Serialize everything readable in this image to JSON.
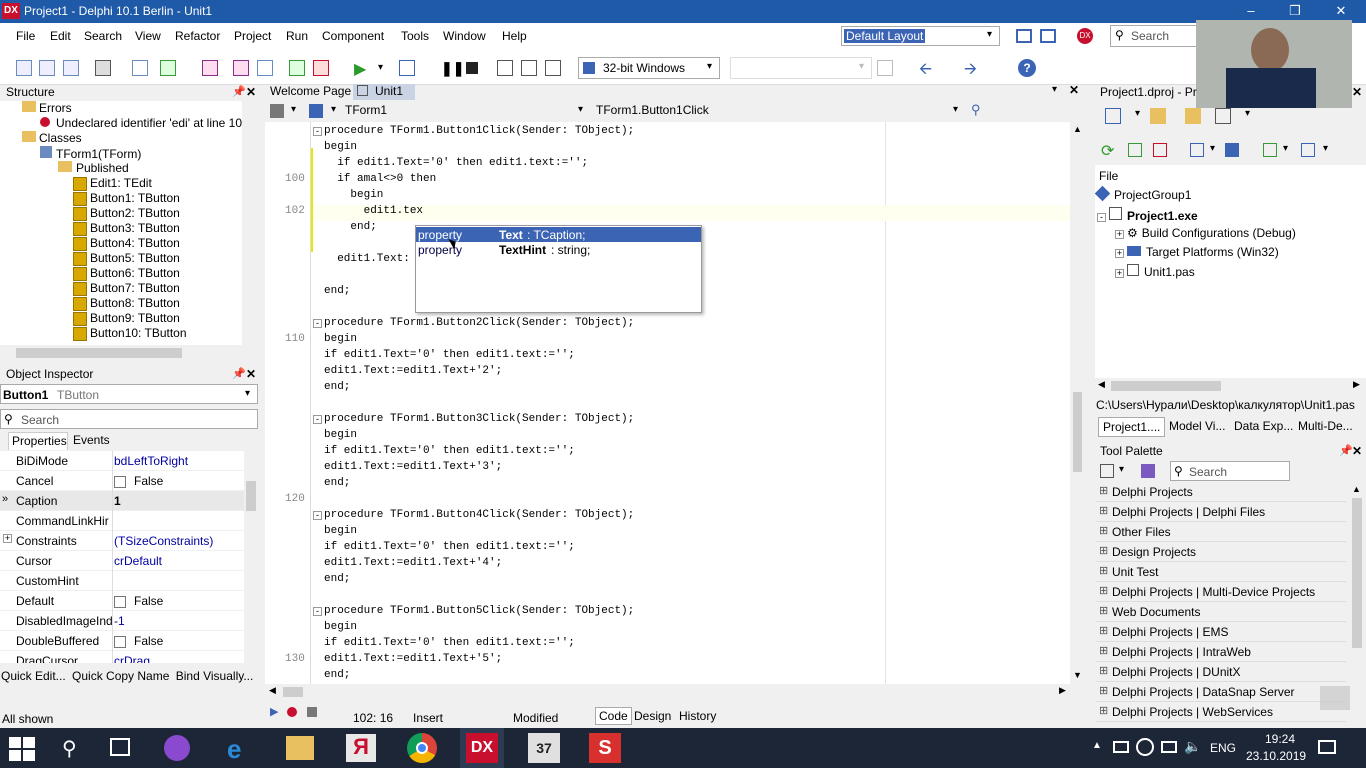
{
  "window": {
    "title": "Project1 - Delphi 10.1 Berlin - Unit1",
    "logo": "DX"
  },
  "menu": [
    "File",
    "Edit",
    "Search",
    "View",
    "Refactor",
    "Project",
    "Run",
    "Component",
    "Tools",
    "Window",
    "Help"
  ],
  "layout_select": "Default Layout",
  "top_search_placeholder": "Search",
  "platform_select": "32-bit Windows",
  "structure": {
    "title": "Structure",
    "errors_label": "Errors",
    "error_text": "Undeclared identifier 'edi' at line 10",
    "classes_label": "Classes",
    "form_label": "TForm1(TForm)",
    "published_label": "Published",
    "items": [
      "Edit1: TEdit",
      "Button1: TButton",
      "Button2: TButton",
      "Button3: TButton",
      "Button4: TButton",
      "Button5: TButton",
      "Button6: TButton",
      "Button7: TButton",
      "Button8: TButton",
      "Button9: TButton",
      "Button10: TButton"
    ]
  },
  "object_inspector": {
    "title": "Object Inspector",
    "selected_name": "Button1",
    "selected_type": "TButton",
    "search_placeholder": "Search",
    "tabs": [
      "Properties",
      "Events"
    ],
    "rows": [
      {
        "name": "BiDiMode",
        "value": "bdLeftToRight",
        "check": false
      },
      {
        "name": "Cancel",
        "value": "False",
        "check": true
      },
      {
        "name": "Caption",
        "value": "1",
        "check": false
      },
      {
        "name": "CommandLinkHir",
        "value": "",
        "check": false
      },
      {
        "name": "Constraints",
        "value": "(TSizeConstraints)",
        "check": false
      },
      {
        "name": "Cursor",
        "value": "crDefault",
        "check": false
      },
      {
        "name": "CustomHint",
        "value": "",
        "check": false
      },
      {
        "name": "Default",
        "value": "False",
        "check": true
      },
      {
        "name": "DisabledImageInd",
        "value": "-1",
        "check": false
      },
      {
        "name": "DoubleBuffered",
        "value": "False",
        "check": true
      },
      {
        "name": "DragCursor",
        "value": "crDrag",
        "check": false
      }
    ],
    "footer_links": [
      "Quick Edit...",
      "Quick Copy Name",
      "Bind Visually..."
    ],
    "status": "All shown"
  },
  "editor": {
    "tabs": [
      "Welcome Page",
      "Unit1"
    ],
    "class_select": "TForm1",
    "method_select": "TForm1.Button1Click",
    "line_numbers": [
      "100",
      "102",
      "110",
      "120",
      "130"
    ],
    "lines": [
      "procedure TForm1.Button1Click(Sender: TObject);",
      "begin",
      "  if edit1.Text='0' then edit1.text:='';",
      "  if amal<>0 then",
      "    begin",
      "      edit1.tex",
      "    end;",
      "",
      "  edit1.Text:",
      "",
      "end;",
      "",
      "procedure TForm1.Button2Click(Sender: TObject);",
      "begin",
      "if edit1.Text='0' then edit1.text:='';",
      "edit1.Text:=edit1.Text+'2';",
      "end;",
      "",
      "procedure TForm1.Button3Click(Sender: TObject);",
      "begin",
      "if edit1.Text='0' then edit1.text:='';",
      "edit1.Text:=edit1.Text+'3';",
      "end;",
      "",
      "procedure TForm1.Button4Click(Sender: TObject);",
      "begin",
      "if edit1.Text='0' then edit1.text:='';",
      "edit1.Text:=edit1.Text+'4';",
      "end;",
      "",
      "procedure TForm1.Button5Click(Sender: TObject);",
      "begin",
      "if edit1.Text='0' then edit1.text:='';",
      "edit1.Text:=edit1.Text+'5';",
      "end;"
    ],
    "completion": [
      {
        "kind": "property",
        "name": "Text",
        "type": ": TCaption;"
      },
      {
        "kind": "property",
        "name": "TextHint",
        "type": ": string;"
      }
    ],
    "status": {
      "position": "102: 16",
      "mode": "Insert",
      "modified": "Modified"
    },
    "bottom_tabs": [
      "Code",
      "Design",
      "History"
    ]
  },
  "project": {
    "title": "Project1.dproj - Pr",
    "file_label": "File",
    "group": "ProjectGroup1",
    "exe": "Project1.exe",
    "children": [
      "Build Configurations (Debug)",
      "Target Platforms (Win32)",
      "Unit1.pas"
    ],
    "path": "C:\\Users\\Нурали\\Desktop\\калкулятор\\Unit1.pas",
    "tabs": [
      "Project1....",
      "Model Vi...",
      "Data Exp...",
      "Multi-De..."
    ]
  },
  "palette": {
    "title": "Tool Palette",
    "search_placeholder": "Search",
    "items": [
      "Delphi Projects",
      "Delphi Projects | Delphi Files",
      "Other Files",
      "Design Projects",
      "Unit Test",
      "Delphi Projects | Multi-Device Projects",
      "Web Documents",
      "Delphi Projects | EMS",
      "Delphi Projects | IntraWeb",
      "Delphi Projects | DUnitX",
      "Delphi Projects | DataSnap Server",
      "Delphi Projects | WebServices"
    ]
  },
  "taskbar": {
    "lang": "ENG",
    "time": "19:24",
    "date": "23.10.2019"
  },
  "colors": {
    "titlebar": "#1e5aa8",
    "selection": "#3c64b4",
    "keyword": "#000000",
    "string": "#0000c8",
    "taskbar": "#1c2636"
  }
}
